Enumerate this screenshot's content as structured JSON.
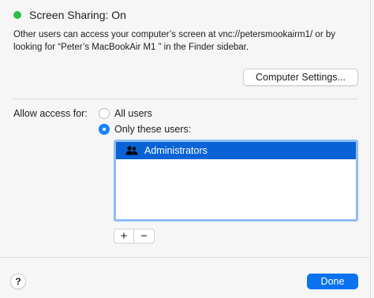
{
  "status": {
    "title": "Screen Sharing: On",
    "dot_color": "#2fbd49"
  },
  "description": {
    "line1": "Other users can access your computer’s screen at vnc://petersmookairm1/ or by",
    "line2": "looking for “Peter’s MacBookAir M1 ” in the Finder sidebar."
  },
  "buttons": {
    "computer_settings": "Computer Settings...",
    "help": "?",
    "done": "Done"
  },
  "access": {
    "label": "Allow access for:",
    "options": [
      {
        "label": "All users",
        "selected": false
      },
      {
        "label": "Only these users:",
        "selected": true
      }
    ]
  },
  "user_list": {
    "items": [
      {
        "label": "Administrators",
        "icon": "group-icon",
        "selected": true
      }
    ]
  },
  "list_controls": {
    "add": "+",
    "remove": "−"
  },
  "colors": {
    "accent": "#0a72ee",
    "selection": "#0a63d6",
    "focus_ring": "#8fbdf5"
  }
}
